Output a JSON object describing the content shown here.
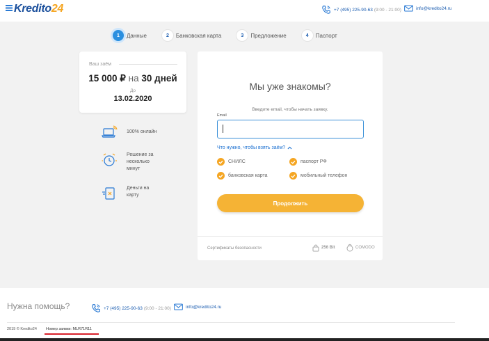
{
  "header": {
    "logo_main": "Kredito",
    "logo_num": "24",
    "phone": "+7 (495) 225-90-63",
    "hours": "(9:00 - 21:00)",
    "email": "info@kredito24.ru"
  },
  "steps": [
    {
      "num": "1",
      "label": "Данные"
    },
    {
      "num": "2",
      "label": "Банковская карта"
    },
    {
      "num": "3",
      "label": "Предложение"
    },
    {
      "num": "4",
      "label": "Паспорт"
    }
  ],
  "loan": {
    "label": "Ваш заём",
    "amount": "15 000 ₽",
    "na": "на",
    "term": "30 дней",
    "until_label": "До",
    "date": "13.02.2020"
  },
  "features": [
    {
      "icon": "laptop-wifi-icon",
      "text": "100% онлайн"
    },
    {
      "icon": "alarm-clock-icon",
      "text": "Решение за несколько минут"
    },
    {
      "icon": "money-transfer-icon",
      "text": "Деньги на карту"
    }
  ],
  "form": {
    "title": "Мы уже знакомы?",
    "subtitle": "Введите email, чтобы начать заявку.",
    "email_label": "Email",
    "email_value": "",
    "need_link": "Что нужно, чтобы взять заём?",
    "requirements": [
      "СНИЛС",
      "паспорт РФ",
      "банковская карта",
      "мобильный телефон"
    ],
    "submit_label": "Продолжить",
    "certs_label": "Сертификаты безопасности",
    "ssl_badge": "256 Bit",
    "comodo_badge": "COMODO"
  },
  "footer": {
    "help": "Нужна помощь?",
    "phone": "+7 (495) 225-90-63",
    "hours": "(9:00 - 21:00)",
    "email": "info@kredito24.ru",
    "copyright": "2019 © Kredito24",
    "order_label": "Номер заявки:",
    "order_number": "MLR71R11"
  },
  "colors": {
    "brand_blue": "#1a4f9c",
    "accent_orange": "#f5a623",
    "link_blue": "#1a6fd0",
    "step_active": "#2a8fe0",
    "highlight_red": "#d8202a"
  }
}
